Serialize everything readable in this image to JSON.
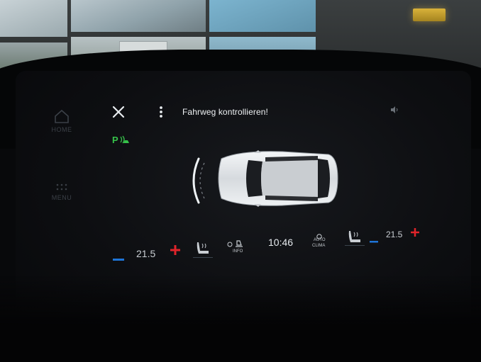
{
  "header": {
    "title": "Fahrweg kontrollieren!",
    "close_icon": "close-icon",
    "more_icon": "more-vertical-icon",
    "speaker_icon": "speaker-icon"
  },
  "side_nav": {
    "home_label": "HOME",
    "menu_label": "MENU"
  },
  "park_assist": {
    "label": "P",
    "color": "#36c24a"
  },
  "climate": {
    "left_temp": "21.5",
    "right_temp": "21.5",
    "clock": "10:46",
    "info_label": "INFO",
    "auto_label": "AUTO",
    "clima_label": "CLIMA",
    "minus_color": "#1e74d6",
    "plus_color": "#e0242a"
  }
}
